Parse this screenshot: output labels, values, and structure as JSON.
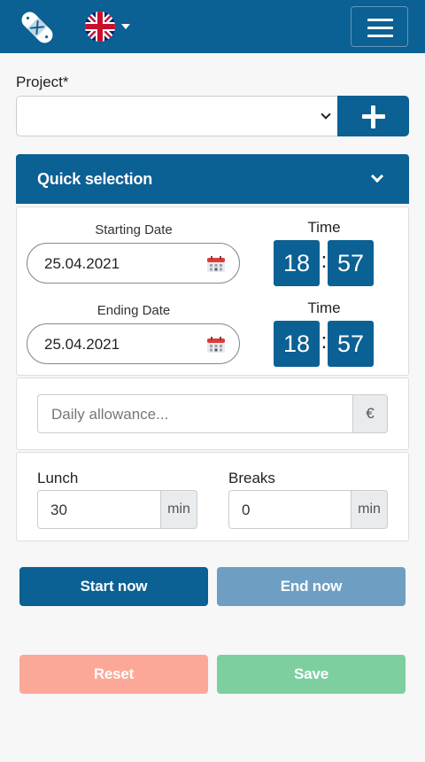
{
  "header": {
    "logo_icon": "bandage-icon",
    "language_flag": "uk-flag-icon",
    "menu_icon": "hamburger-icon"
  },
  "project": {
    "label": "Project*",
    "selected": "",
    "add_icon": "plus-icon"
  },
  "quick_selection": {
    "label": "Quick selection",
    "icon": "chevron-down-icon"
  },
  "start": {
    "date_label": "Starting Date",
    "date": "25.04.2021",
    "time_label": "Time",
    "hour": "18",
    "minute": "57",
    "separator": ":"
  },
  "end": {
    "date_label": "Ending Date",
    "date": "25.04.2021",
    "time_label": "Time",
    "hour": "18",
    "minute": "57",
    "separator": ":"
  },
  "allowance": {
    "placeholder": "Daily allowance...",
    "currency": "€"
  },
  "lunch": {
    "label": "Lunch",
    "value": "30",
    "unit": "min"
  },
  "breaks": {
    "label": "Breaks",
    "value": "0",
    "unit": "min"
  },
  "buttons": {
    "start_now": "Start now",
    "end_now": "End now",
    "reset": "Reset",
    "save": "Save"
  },
  "colors": {
    "primary": "#0b6094",
    "primary_disabled": "#6e9fc2",
    "reset": "#fca898",
    "save": "#7ecf9f"
  }
}
